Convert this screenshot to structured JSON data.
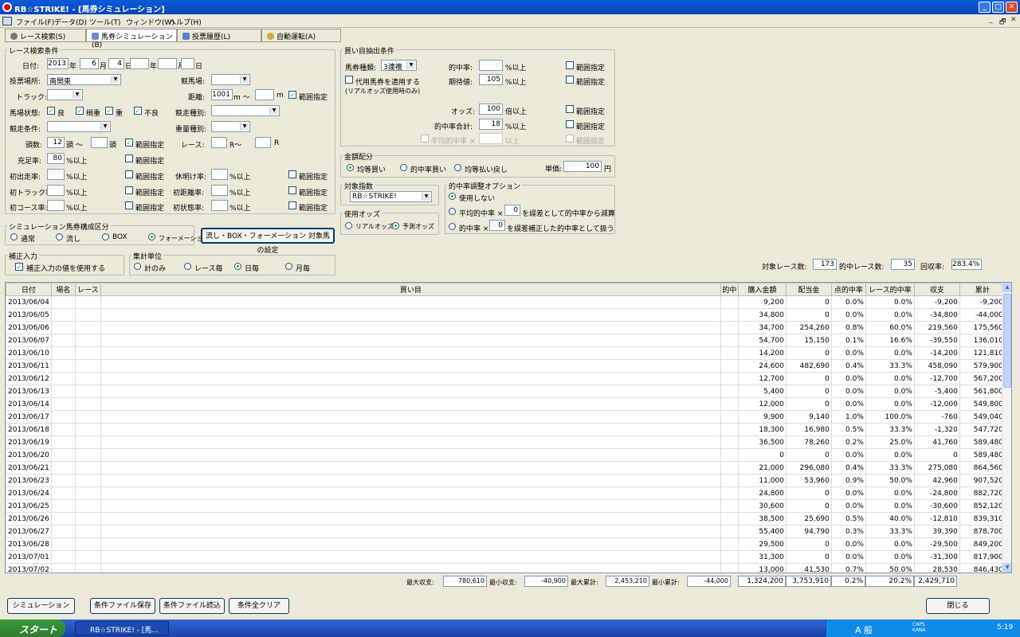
{
  "window": {
    "title": "RB☆STRIKE! - [馬券シミュレーション]",
    "min": "_",
    "max": "□",
    "close": "✕"
  },
  "menu": [
    "ファイル(F)",
    "データ(D)",
    "ツール(T)",
    "ウィンドウ(W)",
    "ヘルプ(H)"
  ],
  "mdi_controls": [
    "_",
    "🗗",
    "✕"
  ],
  "tabs": [
    "レース検索(S)",
    "馬券シミュレーション(B)",
    "投票履歴(L)",
    "自動運転(A)"
  ],
  "race": {
    "group": "レース検索条件",
    "date_label": "日付:",
    "year": "2013",
    "year_u": "年",
    "month": "6",
    "month_u": "月",
    "day": "4",
    "day_u": "日〜",
    "year2_u": "年",
    "month2_u": "月",
    "day2_u": "日",
    "venue_label": "投票場所:",
    "venue": "南関東",
    "keiba_label": "競馬場:",
    "distance_label": "距離:",
    "distance": "1001",
    "m_tilde": "m 〜",
    "m": "m",
    "range": "範囲指定",
    "track_label": "トラック:",
    "baba_label": "馬場状態:",
    "baba": [
      "良",
      "稍重",
      "重",
      "不良"
    ],
    "sokan_label": "競走種別:",
    "kyoso_label": "競走条件:",
    "juryo_label": "重量種別:",
    "heads_label": "頭数:",
    "heads": "12",
    "tou_tilde": "頭 〜",
    "tou": "頭",
    "race_label": "レース:",
    "r_tilde": "R〜",
    "r": "R",
    "jusoku_label": "充足率:",
    "jusoku": "80",
    "pct_up": "%以上",
    "rows": [
      "初出走率:",
      "初トラック率:",
      "初コース率:"
    ],
    "rows2": [
      "休明け率:",
      "初距離率:",
      "初状態率:"
    ]
  },
  "buy": {
    "group": "買い目抽出条件",
    "type_label": "馬券種類:",
    "type": "3連複",
    "hit_label": "的中率:",
    "exp_label": "期待値:",
    "exp": "105",
    "pct_up": "%以上",
    "daiyou": "代用馬券を適用する",
    "daiyou2": "(リアルオッズ使用時のみ)",
    "odds_label": "オッズ:",
    "odds": "100",
    "bai_up": "倍以上",
    "sum_label": "的中率合計:",
    "sum": "18",
    "avg_label": "平均的中率 ×",
    "avg_up": "以上",
    "range": "範囲指定"
  },
  "money": {
    "group": "金額配分",
    "opts": [
      "均等買い",
      "的中率買い",
      "均等払い戻し"
    ],
    "unit_label": "単価:",
    "unit": "100",
    "yen": "円"
  },
  "target": {
    "group": "対象指数",
    "value": "RB☆STRIKE!"
  },
  "odds_use": {
    "group": "使用オッズ",
    "opts": [
      "リアルオッズ",
      "予測オッズ"
    ]
  },
  "hitadj": {
    "group": "的中率調整オプション",
    "opt1": "使用しない",
    "opt2a": "平均的中率 ×",
    "opt2v": "0",
    "opt2b": "を誤差として的中率から減算",
    "opt3a": "的中率 ×",
    "opt3v": "0",
    "opt3b": "を誤差補正した的中率として扱う"
  },
  "simkind": {
    "group": "シミュレーション馬券構成区分",
    "opts": [
      "通常",
      "流し",
      "BOX",
      "フォーメーション"
    ]
  },
  "setbtn": "流し・BOX・フォーメーション 対象馬の設定",
  "hosei": {
    "group": "補正入力",
    "check": "補正入力の値を使用する"
  },
  "agg": {
    "group": "集計単位",
    "opts": [
      "計のみ",
      "レース毎",
      "日毎",
      "月毎"
    ]
  },
  "stats": {
    "races_label": "対象レース数:",
    "races": "173",
    "hits_label": "的中レース数:",
    "hits": "35",
    "ret_label": "回収率:",
    "ret": "283.4%"
  },
  "table": {
    "headers": [
      "日付",
      "場名",
      "レース",
      "買い目",
      "的中",
      "購入金額",
      "配当金",
      "点的中率",
      "レース的中率",
      "収支",
      "累計"
    ],
    "rows": [
      [
        "2013/06/04",
        "9,200",
        "0",
        "0.0%",
        "0.0%",
        "-9,200",
        "-9,200"
      ],
      [
        "2013/06/05",
        "34,800",
        "0",
        "0.0%",
        "0.0%",
        "-34,800",
        "-44,000"
      ],
      [
        "2013/06/06",
        "34,700",
        "254,260",
        "0.8%",
        "60.0%",
        "219,560",
        "175,560"
      ],
      [
        "2013/06/07",
        "54,700",
        "15,150",
        "0.1%",
        "16.6%",
        "-39,550",
        "136,010"
      ],
      [
        "2013/06/10",
        "14,200",
        "0",
        "0.0%",
        "0.0%",
        "-14,200",
        "121,810"
      ],
      [
        "2013/06/11",
        "24,600",
        "482,690",
        "0.4%",
        "33.3%",
        "458,090",
        "579,900"
      ],
      [
        "2013/06/12",
        "12,700",
        "0",
        "0.0%",
        "0.0%",
        "-12,700",
        "567,200"
      ],
      [
        "2013/06/13",
        "5,400",
        "0",
        "0.0%",
        "0.0%",
        "-5,400",
        "561,800"
      ],
      [
        "2013/06/14",
        "12,000",
        "0",
        "0.0%",
        "0.0%",
        "-12,000",
        "549,800"
      ],
      [
        "2013/06/17",
        "9,900",
        "9,140",
        "1.0%",
        "100.0%",
        "-760",
        "549,040"
      ],
      [
        "2013/06/18",
        "18,300",
        "16,980",
        "0.5%",
        "33.3%",
        "-1,320",
        "547,720"
      ],
      [
        "2013/06/19",
        "36,500",
        "78,260",
        "0.2%",
        "25.0%",
        "41,760",
        "589,480"
      ],
      [
        "2013/06/20",
        "0",
        "0",
        "0.0%",
        "0.0%",
        "0",
        "589,480"
      ],
      [
        "2013/06/21",
        "21,000",
        "296,080",
        "0.4%",
        "33.3%",
        "275,080",
        "864,560"
      ],
      [
        "2013/06/23",
        "11,000",
        "53,960",
        "0.9%",
        "50.0%",
        "42,960",
        "907,520"
      ],
      [
        "2013/06/24",
        "24,800",
        "0",
        "0.0%",
        "0.0%",
        "-24,800",
        "882,720"
      ],
      [
        "2013/06/25",
        "30,600",
        "0",
        "0.0%",
        "0.0%",
        "-30,600",
        "852,120"
      ],
      [
        "2013/06/26",
        "38,500",
        "25,690",
        "0.5%",
        "40.0%",
        "-12,810",
        "839,310"
      ],
      [
        "2013/06/27",
        "55,400",
        "94,790",
        "0.3%",
        "33.3%",
        "39,390",
        "878,700"
      ],
      [
        "2013/06/28",
        "29,500",
        "0",
        "0.0%",
        "0.0%",
        "-29,500",
        "849,200"
      ],
      [
        "2013/07/01",
        "31,300",
        "0",
        "0.0%",
        "0.0%",
        "-31,300",
        "817,900"
      ],
      [
        "2013/07/02",
        "13,000",
        "41,530",
        "0.7%",
        "50.0%",
        "28,530",
        "846,430"
      ]
    ]
  },
  "summary": {
    "max_label": "最大収支:",
    "max": "780,610",
    "min_label": "最小収支:",
    "min": "-40,900",
    "maxc_label": "最大累計:",
    "maxc": "2,453,210",
    "minc_label": "最小累計:",
    "minc": "-44,000",
    "buy": "1,324,200",
    "pay": "3,753,910",
    "pt": "0.2%",
    "race": "20.2%",
    "total": "2,429,710"
  },
  "buttons": {
    "sim": "シミュレーション",
    "save": "条件ファイル保存",
    "load": "条件ファイル読込",
    "clear": "条件全クリア",
    "close": "閉じる"
  },
  "taskbar": {
    "start": "スタート",
    "task": "RB☆STRIKE! - [馬...",
    "ime": "A 般",
    "caps": "CAPS KANA",
    "clock": "5:19"
  }
}
